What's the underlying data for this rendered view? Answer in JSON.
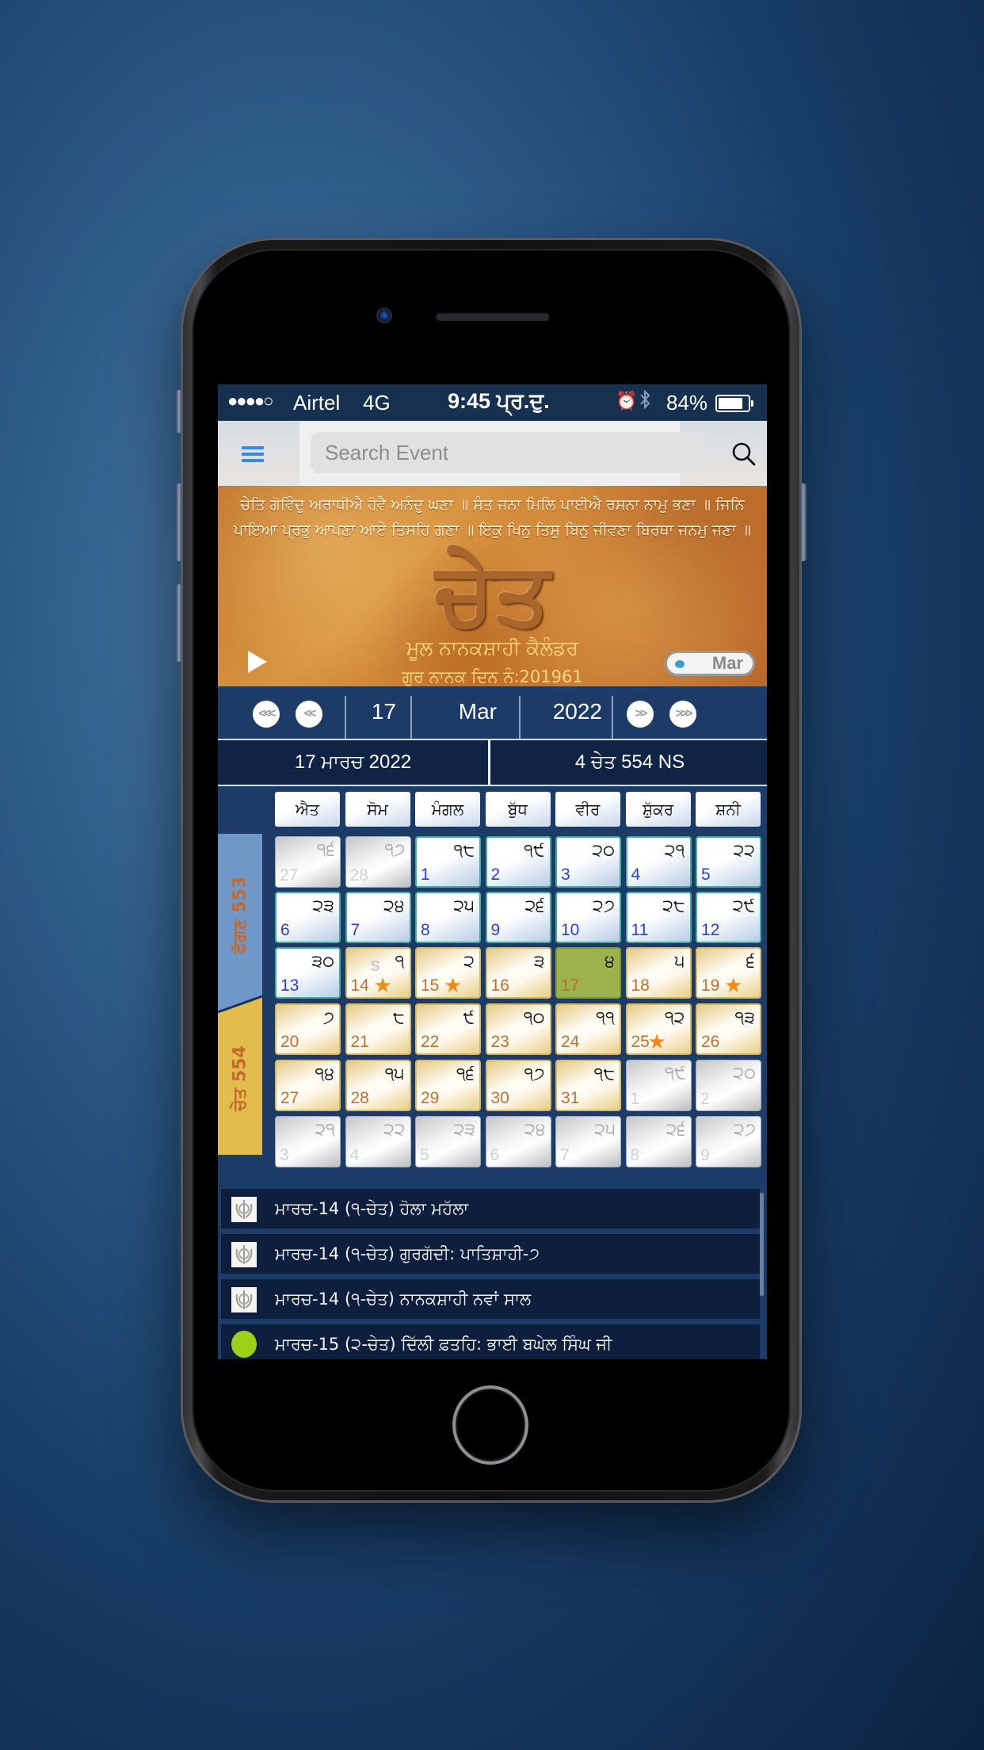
{
  "status_bar": {
    "signal": "●●●●○",
    "carrier": "Airtel",
    "network": "4G",
    "time": "9:45 ਪ੍ਰ.ਦੁ.",
    "alarm_icon": "⏰",
    "bluetooth_icon": "✱",
    "battery": "84%"
  },
  "header": {
    "menu_icon": "list-icon",
    "search_placeholder": "Search Event",
    "search_icon": "magnifier-icon"
  },
  "banner": {
    "verse": "ਚੇਤਿ ਗੋਵਿੰਦੁ ਅਰਾਧੀਐ ਹੋਵੈ ਅਨੰਦੁ ਘਣਾ ॥ ਸੰਤ ਜਨਾ ਮਿਲਿ ਪਾਈਐ ਰਸਨਾ ਨਾਮੁ ਭਣਾ ॥ ਜਿਨਿ ਪਾਇਆ ਪ੍ਰਭੁ ਆਪਣਾ ਆਏ ਤਿਸਹਿ ਗਣਾ ॥ ਇਕੁ ਖਿਨੁ ਤਿਸੁ ਬਿਨੁ ਜੀਵਣਾ ਬਿਰਥਾ ਜਨਮੁ ਜਣਾ ॥",
    "month_title": "ਚੇਤ",
    "subtitle": "ਮੂਲ ਨਾਨਕਸ਼ਾਹੀ ਕੈਲੰਡਰ",
    "day_count": "ਗੁਰ ਨਾਨਕ ਦਿਨ ਨੰ:201961",
    "toggle_label": "Mar"
  },
  "nav": {
    "fast_back": "<<<",
    "back": "<<",
    "day": "17",
    "month": "Mar",
    "year": "2022",
    "forward": ">>",
    "fast_forward": ">>>"
  },
  "date_row": {
    "gregorian": "17 ਮਾਰਚ  2022",
    "nanakshahi": "4 ਚੇਤ 554 NS"
  },
  "weekdays": [
    "ਐਤ",
    "ਸੋਮ",
    "ਮੰਗਲ",
    "ਬੁੱਧ",
    "ਵੀਰ",
    "ਸ਼ੁੱਕਰ",
    "ਸ਼ਨੀ"
  ],
  "month_bands": {
    "previous": "ਫੱਗਣ 553",
    "current": "ਚੇਤ 554",
    "previous_color": "#6f98c8",
    "current_color": "#e2bd4e"
  },
  "calendar": {
    "selected_gregorian": 17,
    "rows": [
      [
        {
          "nk": "੧੬",
          "gd": "27",
          "type": "out"
        },
        {
          "nk": "੧੭",
          "gd": "28",
          "type": "out"
        },
        {
          "nk": "੧੮",
          "gd": "1",
          "type": "cur"
        },
        {
          "nk": "੧੯",
          "gd": "2",
          "type": "cur"
        },
        {
          "nk": "੨੦",
          "gd": "3",
          "type": "cur"
        },
        {
          "nk": "੨੧",
          "gd": "4",
          "type": "cur"
        },
        {
          "nk": "੨੨",
          "gd": "5",
          "type": "cur"
        }
      ],
      [
        {
          "nk": "੨੩",
          "gd": "6",
          "type": "cur"
        },
        {
          "nk": "੨੪",
          "gd": "7",
          "type": "cur"
        },
        {
          "nk": "੨੫",
          "gd": "8",
          "type": "cur"
        },
        {
          "nk": "੨੬",
          "gd": "9",
          "type": "cur"
        },
        {
          "nk": "੨੭",
          "gd": "10",
          "type": "cur"
        },
        {
          "nk": "੨੮",
          "gd": "11",
          "type": "cur"
        },
        {
          "nk": "੨੯",
          "gd": "12",
          "type": "cur"
        }
      ],
      [
        {
          "nk": "੩੦",
          "gd": "13",
          "type": "cur"
        },
        {
          "nk": "੧",
          "gd": "14",
          "type": "new",
          "star": true,
          "mark": "S"
        },
        {
          "nk": "੨",
          "gd": "15",
          "type": "new",
          "star": true
        },
        {
          "nk": "੩",
          "gd": "16",
          "type": "new"
        },
        {
          "nk": "੪",
          "gd": "17",
          "type": "today"
        },
        {
          "nk": "੫",
          "gd": "18",
          "type": "new"
        },
        {
          "nk": "੬",
          "gd": "19",
          "type": "new",
          "star": true
        }
      ],
      [
        {
          "nk": "੭",
          "gd": "20",
          "type": "new"
        },
        {
          "nk": "੮",
          "gd": "21",
          "type": "new"
        },
        {
          "nk": "੯",
          "gd": "22",
          "type": "new"
        },
        {
          "nk": "੧੦",
          "gd": "23",
          "type": "new"
        },
        {
          "nk": "੧੧",
          "gd": "24",
          "type": "new"
        },
        {
          "nk": "੧੨",
          "gd": "25",
          "type": "new",
          "star": true
        },
        {
          "nk": "੧੩",
          "gd": "26",
          "type": "new"
        }
      ],
      [
        {
          "nk": "੧੪",
          "gd": "27",
          "type": "new"
        },
        {
          "nk": "੧੫",
          "gd": "28",
          "type": "new"
        },
        {
          "nk": "੧੬",
          "gd": "29",
          "type": "new"
        },
        {
          "nk": "੧੭",
          "gd": "30",
          "type": "new"
        },
        {
          "nk": "੧੮",
          "gd": "31",
          "type": "new"
        },
        {
          "nk": "੧੯",
          "gd": "1",
          "type": "out"
        },
        {
          "nk": "੨੦",
          "gd": "2",
          "type": "out"
        }
      ],
      [
        {
          "nk": "੨੧",
          "gd": "3",
          "type": "out"
        },
        {
          "nk": "੨੨",
          "gd": "4",
          "type": "out"
        },
        {
          "nk": "੨੩",
          "gd": "5",
          "type": "out"
        },
        {
          "nk": "੨੪",
          "gd": "6",
          "type": "out"
        },
        {
          "nk": "੨੫",
          "gd": "7",
          "type": "out"
        },
        {
          "nk": "੨੬",
          "gd": "8",
          "type": "out"
        },
        {
          "nk": "੨੭",
          "gd": "9",
          "type": "out"
        }
      ]
    ]
  },
  "events": [
    {
      "icon": "khanda-icon",
      "text": "ਮਾਰਚ-14 (੧-ਚੇਤ) ਹੋਲਾ ਮਹੱਲਾ"
    },
    {
      "icon": "khanda-icon",
      "text": "ਮਾਰਚ-14 (੧-ਚੇਤ) ਗੁਰਗੱਦੀ: ਪਾਤਿਸ਼ਾਹੀ-੭"
    },
    {
      "icon": "khanda-icon",
      "text": "ਮਾਰਚ-14 (੧-ਚੇਤ) ਨਾਨਕਸ਼ਾਹੀ ਨਵਾਂ ਸਾਲ"
    },
    {
      "icon": "green-dot-icon",
      "text": "ਮਾਰਚ-15 (੨-ਚੇਤ) ਦਿੱਲੀ ਫ਼ਤਹਿ: ਭਾਈ ਬਘੇਲ ਸਿੰਘ ਜੀ"
    }
  ]
}
